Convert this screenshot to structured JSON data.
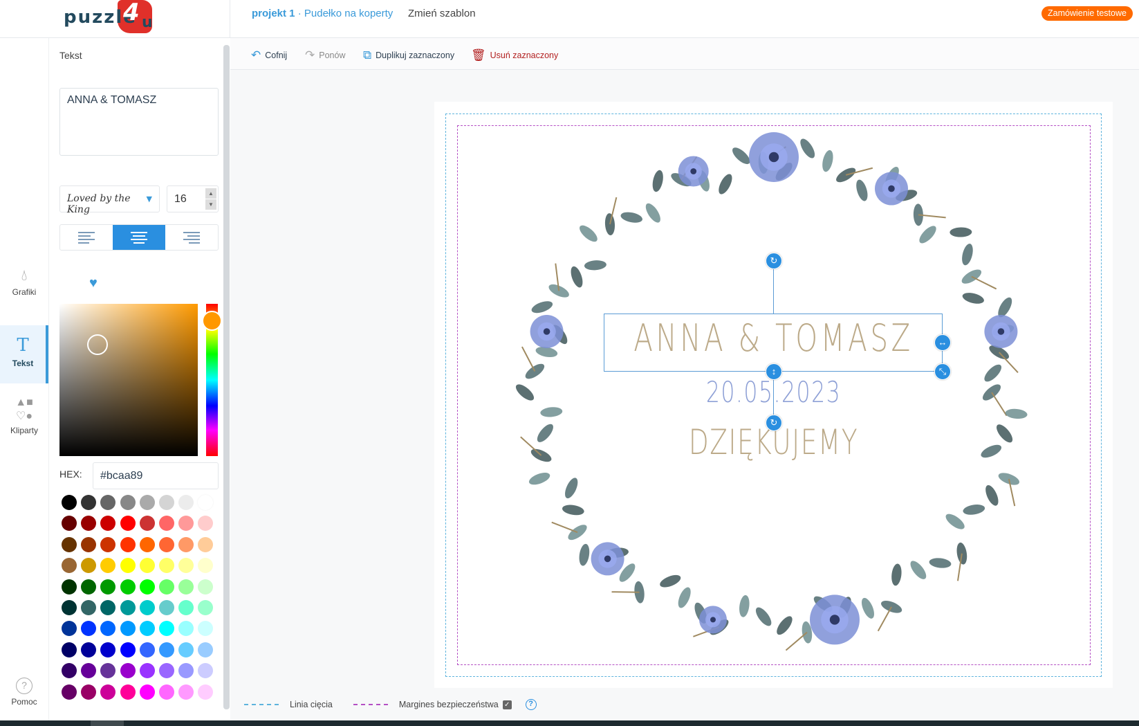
{
  "header": {
    "logo": "puzzle4u",
    "project": "projekt 1",
    "separator": " · ",
    "project_name": "Pudełko na koperty",
    "change_template": "Zmień szablon",
    "test_order": "Zamówienie testowe"
  },
  "sidebar": {
    "items": [
      {
        "label": "Grafiki",
        "icon": "drop-icon"
      },
      {
        "label": "Tekst",
        "icon": "text-icon",
        "active": true
      },
      {
        "label": "Kliparty",
        "icon": "shapes-icon"
      },
      {
        "label": "Pomoc",
        "icon": "help-icon"
      }
    ]
  },
  "panel": {
    "title": "Tekst",
    "text_value": "ANNA & TOMASZ",
    "font": "Loved by the King",
    "font_size": "16",
    "alignment": "center",
    "hex_label": "HEX:",
    "hex_value": "#bcaa89",
    "swatches": [
      [
        "#000000",
        "#333333",
        "#666666",
        "#888888",
        "#aaaaaa",
        "#d4d4d4",
        "#ececec",
        "#ffffff"
      ],
      [
        "#660000",
        "#990000",
        "#cc0000",
        "#ff0000",
        "#cc3333",
        "#ff6666",
        "#ff9999",
        "#ffcccc"
      ],
      [
        "#663300",
        "#993300",
        "#cc3300",
        "#ff3300",
        "#ff6600",
        "#ff6633",
        "#ff9966",
        "#ffcc99"
      ],
      [
        "#996633",
        "#cc9900",
        "#ffcc00",
        "#ffff00",
        "#ffff33",
        "#ffff66",
        "#ffff99",
        "#ffffcc"
      ],
      [
        "#003300",
        "#006600",
        "#009900",
        "#00cc00",
        "#00ff00",
        "#66ff66",
        "#99ff99",
        "#ccffcc"
      ],
      [
        "#003333",
        "#336666",
        "#006666",
        "#009999",
        "#00cccc",
        "#66cccc",
        "#66ffcc",
        "#99ffcc"
      ],
      [
        "#003399",
        "#0033ff",
        "#0066ff",
        "#0099ff",
        "#00ccff",
        "#00ffff",
        "#99ffff",
        "#ccffff"
      ],
      [
        "#000066",
        "#000099",
        "#0000cc",
        "#0000ff",
        "#3366ff",
        "#3399ff",
        "#66ccff",
        "#99ccff"
      ],
      [
        "#330066",
        "#660099",
        "#663399",
        "#9900cc",
        "#9933ff",
        "#9966ff",
        "#9999ff",
        "#ccccff"
      ],
      [
        "#660066",
        "#990066",
        "#cc0099",
        "#ff0099",
        "#ff00ff",
        "#ff66ff",
        "#ff99ff",
        "#ffccff"
      ]
    ]
  },
  "toolbar": {
    "undo": "Cofnij",
    "redo": "Ponów",
    "duplicate": "Duplikuj zaznaczony",
    "delete": "Usuń zaznaczony"
  },
  "canvas": {
    "line1": "ANNA & TOMASZ",
    "line2": "20.05.2023",
    "line3": "DZIĘKUJEMY",
    "text_color": "#bcaa89",
    "date_color": "#8ea0d6"
  },
  "legend": {
    "cut_line": "Linia cięcia",
    "safety_margin": "Margines bezpieczeństwa",
    "safety_checked": true,
    "cut_color": "#5db3dd",
    "margin_color": "#b44fc4"
  }
}
